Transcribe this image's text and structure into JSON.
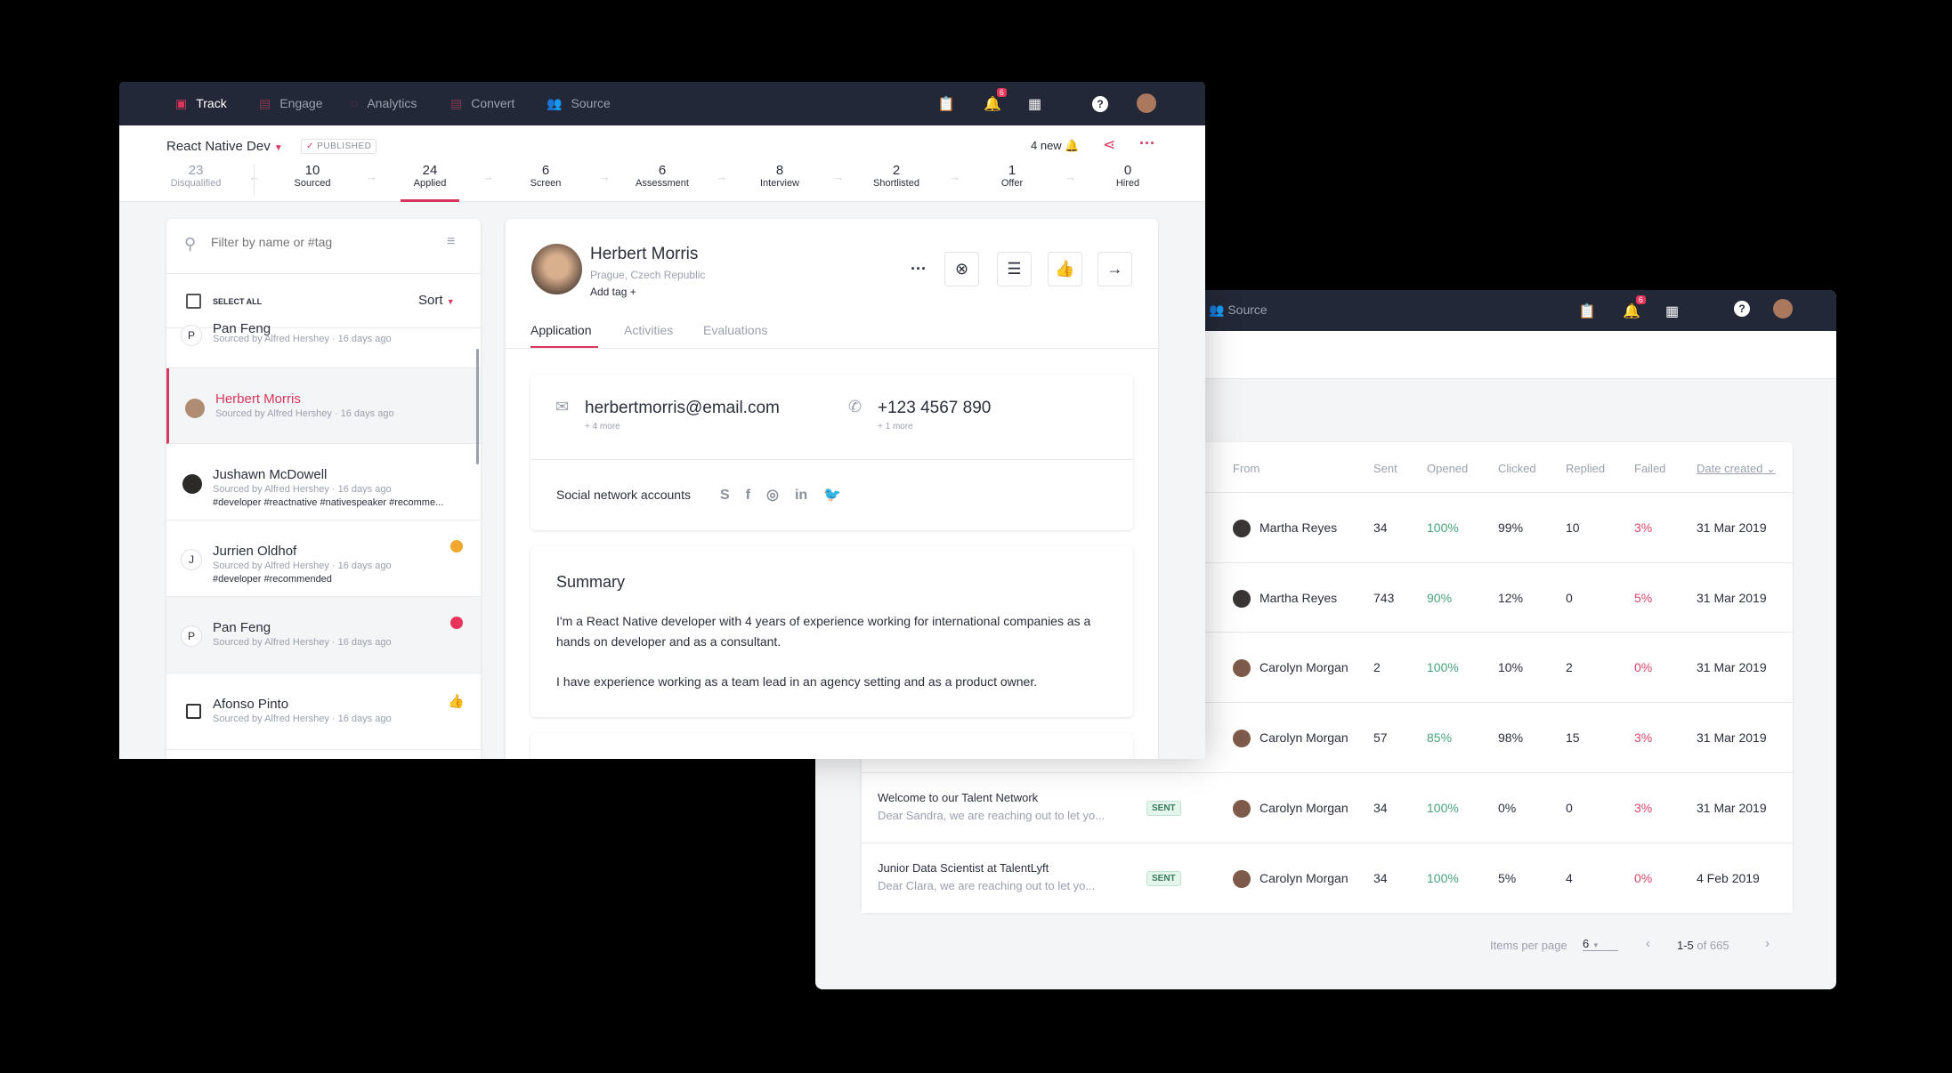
{
  "colors": {
    "accent": "#d9365e",
    "nav_bg": "#232838",
    "positive": "#46a37b",
    "negative": "#d9456a"
  },
  "front": {
    "nav": {
      "items": [
        {
          "label": "Track",
          "icon": "track-icon"
        },
        {
          "label": "Engage",
          "icon": "engage-icon"
        },
        {
          "label": "Analytics",
          "icon": "analytics-icon"
        },
        {
          "label": "Convert",
          "icon": "convert-icon"
        },
        {
          "label": "Source",
          "icon": "source-icon"
        }
      ],
      "notifications_count": "6"
    },
    "job": {
      "title": "React Native Dev",
      "status": "PUBLISHED",
      "new_count": "4 new"
    },
    "pipeline": [
      {
        "count": "23",
        "label": "Disqualified"
      },
      {
        "count": "10",
        "label": "Sourced"
      },
      {
        "count": "24",
        "label": "Applied"
      },
      {
        "count": "6",
        "label": "Screen"
      },
      {
        "count": "6",
        "label": "Assessment"
      },
      {
        "count": "8",
        "label": "Interview"
      },
      {
        "count": "2",
        "label": "Shortlisted"
      },
      {
        "count": "1",
        "label": "Offer"
      },
      {
        "count": "0",
        "label": "Hired"
      }
    ],
    "list": {
      "search_placeholder": "Filter by name or #tag",
      "select_all": "SELECT ALL",
      "sort": "Sort",
      "candidates": [
        {
          "name": "Pan Feng",
          "meta": "Sourced by Alfred Hershey  ·  16 days ago",
          "initial": "P"
        },
        {
          "name": "Herbert Morris",
          "meta": "Sourced by Alfred Hershey  ·  16 days ago"
        },
        {
          "name": "Jushawn McDowell",
          "meta": "Sourced by Alfred Hershey  ·  16 days ago",
          "tags": "#developer  #reactnative  #nativespeaker  #recomme..."
        },
        {
          "name": "Jurrien Oldhof",
          "meta": "Sourced by Alfred Hershey  ·  16 days ago",
          "tags": "#developer  #recommended",
          "initial": "J"
        },
        {
          "name": "Pan Feng",
          "meta": "Sourced by Alfred Hershey  ·  16 days ago",
          "initial": "P"
        },
        {
          "name": "Afonso Pinto",
          "meta": "Sourced by Alfred Hershey  ·  16 days ago"
        }
      ]
    },
    "profile": {
      "name": "Herbert Morris",
      "location": "Prague, Czech Republic",
      "add_tag": "Add tag +",
      "tabs": [
        "Application",
        "Activities",
        "Evaluations"
      ],
      "email": "herbertmorris@email.com",
      "email_more": "+ 4 more",
      "phone": "+123 4567 890",
      "phone_more": "+ 1 more",
      "social_label": "Social network accounts",
      "summary_title": "Summary",
      "summary_p1": "I'm a React Native developer with 4 years of experience working for international companies as a hands on developer and as a consultant.",
      "summary_p2": "I have experience working as a team lead in an agency setting and as a product owner."
    }
  },
  "back": {
    "nav": {
      "source": "Source",
      "notifications_count": "6"
    },
    "table": {
      "headers": [
        "From",
        "Sent",
        "Opened",
        "Clicked",
        "Replied",
        "Failed",
        "Date created"
      ],
      "rows": [
        {
          "title": "",
          "preview": "",
          "status": "",
          "from": "Martha Reyes",
          "sent": "34",
          "opened": "100%",
          "clicked": "99%",
          "replied": "10",
          "failed": "3%",
          "date": "31 Mar 2019"
        },
        {
          "title": "",
          "preview": "",
          "status": "",
          "from": "Martha Reyes",
          "sent": "743",
          "opened": "90%",
          "clicked": "12%",
          "replied": "0",
          "failed": "5%",
          "date": "31 Mar 2019"
        },
        {
          "title": "",
          "preview": "",
          "status": "",
          "from": "Carolyn Morgan",
          "sent": "2",
          "opened": "100%",
          "clicked": "10%",
          "replied": "2",
          "failed": "0%",
          "date": "31 Mar 2019"
        },
        {
          "title": "",
          "preview": "",
          "status": "",
          "from": "Carolyn Morgan",
          "sent": "57",
          "opened": "85%",
          "clicked": "98%",
          "replied": "15",
          "failed": "3%",
          "date": "31 Mar 2019"
        },
        {
          "title": "Welcome to our Talent Network",
          "preview": "Dear Sandra, we are reaching out to let yo...",
          "status": "SENT",
          "from": "Carolyn Morgan",
          "sent": "34",
          "opened": "100%",
          "clicked": "0%",
          "replied": "0",
          "failed": "3%",
          "date": "31 Mar 2019"
        },
        {
          "title": "Junior Data Scientist at TalentLyft",
          "preview": "Dear Clara, we are reaching out to let yo...",
          "status": "SENT",
          "from": "Carolyn Morgan",
          "sent": "34",
          "opened": "100%",
          "clicked": "5%",
          "replied": "4",
          "failed": "0%",
          "date": "4 Feb 2019"
        }
      ]
    },
    "pagination": {
      "label": "Items per page",
      "per_page": "6",
      "range": "1-5",
      "of": "of 665"
    }
  }
}
